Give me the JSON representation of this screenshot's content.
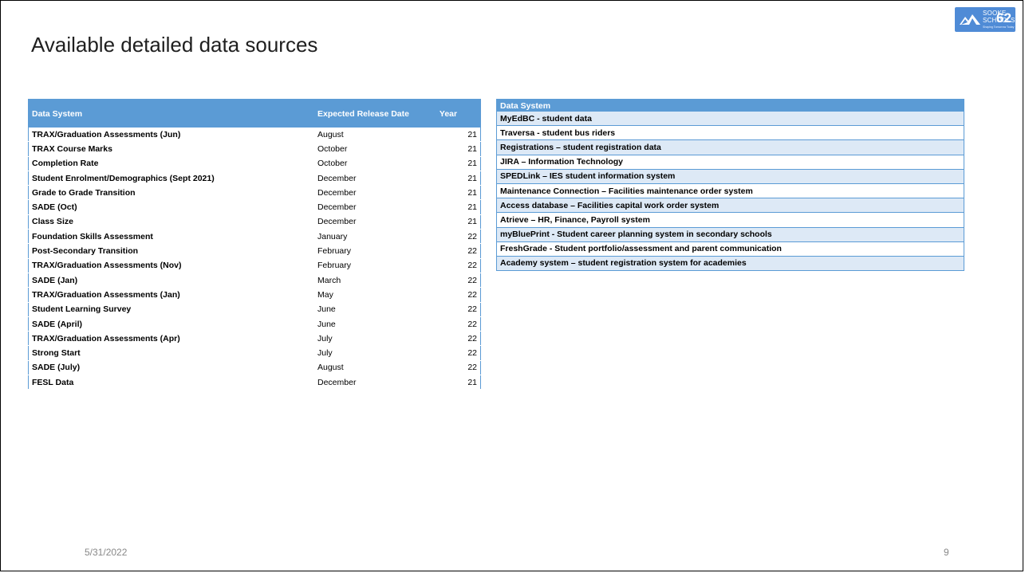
{
  "slide": {
    "title": "Available detailed data sources",
    "date": "5/31/2022",
    "page_number": "9"
  },
  "logo": {
    "line1": "SOOKE",
    "line2": "SCHOOLS",
    "number": "62",
    "tagline": "Shaping Tomorrow Today",
    "color": "#4f8bd6"
  },
  "left_table": {
    "headers": {
      "system": "Data System",
      "release": "Expected Release Date",
      "year": "Year"
    },
    "rows": [
      {
        "system": "TRAX/Graduation Assessments (Jun)",
        "release": "August",
        "year": "21"
      },
      {
        "system": "TRAX Course Marks",
        "release": "October",
        "year": "21"
      },
      {
        "system": "Completion Rate",
        "release": "October",
        "year": "21"
      },
      {
        "system": "Student Enrolment/Demographics (Sept 2021)",
        "release": "December",
        "year": "21"
      },
      {
        "system": "Grade to Grade Transition",
        "release": "December",
        "year": "21"
      },
      {
        "system": "SADE (Oct)",
        "release": "December",
        "year": "21"
      },
      {
        "system": "Class Size",
        "release": "December",
        "year": "21"
      },
      {
        "system": "Foundation Skills Assessment",
        "release": "January",
        "year": "22"
      },
      {
        "system": "Post-Secondary Transition",
        "release": "February",
        "year": "22"
      },
      {
        "system": "TRAX/Graduation Assessments (Nov)",
        "release": "February",
        "year": "22"
      },
      {
        "system": "SADE (Jan)",
        "release": "March",
        "year": "22"
      },
      {
        "system": "TRAX/Graduation Assessments (Jan)",
        "release": "May",
        "year": "22"
      },
      {
        "system": "Student Learning Survey",
        "release": "June",
        "year": "22"
      },
      {
        "system": "SADE (April)",
        "release": "June",
        "year": "22"
      },
      {
        "system": "TRAX/Graduation Assessments (Apr)",
        "release": "July",
        "year": "22"
      },
      {
        "system": "Strong Start",
        "release": "July",
        "year": "22"
      },
      {
        "system": "SADE (July)",
        "release": "August",
        "year": "22"
      },
      {
        "system": "FESL Data",
        "release": "December",
        "year": "21"
      }
    ]
  },
  "right_table": {
    "header": "Data System",
    "rows": [
      "MyEdBC - student data",
      "Traversa - student bus riders",
      "Registrations – student registration data",
      "JIRA – Information Technology",
      "SPEDLink – IES student information system",
      "Maintenance Connection – Facilities maintenance order system",
      "Access database – Facilities capital work order system",
      "Atrieve – HR, Finance, Payroll system",
      "myBluePrint - Student career planning system in secondary schools",
      "FreshGrade - Student portfolio/assessment and parent communication",
      "Academy system – student registration system for academies"
    ]
  },
  "colors": {
    "header_blue": "#5b9bd5",
    "row_band": "#dde9f6"
  }
}
